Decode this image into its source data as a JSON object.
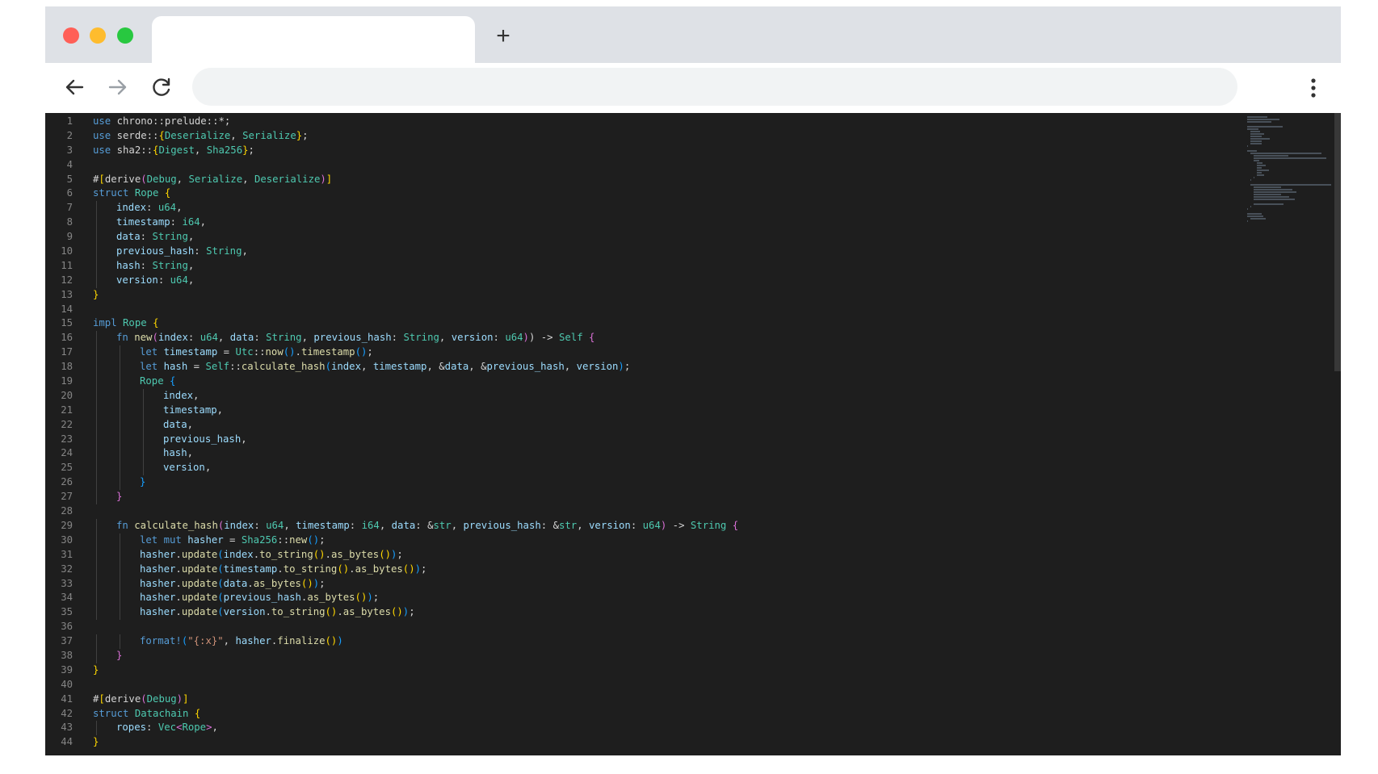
{
  "browser": {
    "new_tab_label": "+",
    "active_tab_title": "",
    "address_text": ""
  },
  "colors": {
    "close": "#ff5f57",
    "minimize": "#febc2e",
    "maximize": "#28c840",
    "editor_background": "#1e1e1e"
  },
  "icons": {
    "back": "arrow-left-icon",
    "forward": "arrow-right-icon",
    "reload": "reload-icon",
    "menu": "kebab-menu-icon"
  },
  "editor": {
    "lines": [
      {
        "n": "1",
        "i": 0,
        "t": [
          [
            "kw",
            "use "
          ],
          [
            "",
            "chrono::prelude::*;"
          ]
        ]
      },
      {
        "n": "2",
        "i": 0,
        "t": [
          [
            "kw",
            "use "
          ],
          [
            "",
            "serde::"
          ],
          [
            "p1",
            "{"
          ],
          [
            "ty",
            "Deserialize"
          ],
          [
            "",
            ", "
          ],
          [
            "ty",
            "Serialize"
          ],
          [
            "p1",
            "}"
          ],
          [
            "",
            ";"
          ]
        ]
      },
      {
        "n": "3",
        "i": 0,
        "t": [
          [
            "kw",
            "use "
          ],
          [
            "",
            "sha2::"
          ],
          [
            "p1",
            "{"
          ],
          [
            "ty",
            "Digest"
          ],
          [
            "",
            ", "
          ],
          [
            "ty",
            "Sha256"
          ],
          [
            "p1",
            "}"
          ],
          [
            "",
            ";"
          ]
        ]
      },
      {
        "n": "4",
        "i": 0,
        "t": []
      },
      {
        "n": "5",
        "i": 0,
        "t": [
          [
            "",
            "#"
          ],
          [
            "p1",
            "["
          ],
          [
            "",
            "derive"
          ],
          [
            "p2",
            "("
          ],
          [
            "ty",
            "Debug"
          ],
          [
            "",
            ", "
          ],
          [
            "ty",
            "Serialize"
          ],
          [
            "",
            ", "
          ],
          [
            "ty",
            "Deserialize"
          ],
          [
            "p2",
            ")"
          ],
          [
            "p1",
            "]"
          ]
        ]
      },
      {
        "n": "6",
        "i": 0,
        "t": [
          [
            "kw",
            "struct "
          ],
          [
            "ty",
            "Rope "
          ],
          [
            "p1",
            "{"
          ]
        ]
      },
      {
        "n": "7",
        "i": 1,
        "t": [
          [
            "var",
            "index"
          ],
          [
            "",
            ": "
          ],
          [
            "ty",
            "u64"
          ],
          [
            "",
            ","
          ]
        ]
      },
      {
        "n": "8",
        "i": 1,
        "t": [
          [
            "var",
            "timestamp"
          ],
          [
            "",
            ": "
          ],
          [
            "ty",
            "i64"
          ],
          [
            "",
            ","
          ]
        ]
      },
      {
        "n": "9",
        "i": 1,
        "t": [
          [
            "var",
            "data"
          ],
          [
            "",
            ": "
          ],
          [
            "ty",
            "String"
          ],
          [
            "",
            ","
          ]
        ]
      },
      {
        "n": "10",
        "i": 1,
        "t": [
          [
            "var",
            "previous_hash"
          ],
          [
            "",
            ": "
          ],
          [
            "ty",
            "String"
          ],
          [
            "",
            ","
          ]
        ]
      },
      {
        "n": "11",
        "i": 1,
        "t": [
          [
            "var",
            "hash"
          ],
          [
            "",
            ": "
          ],
          [
            "ty",
            "String"
          ],
          [
            "",
            ","
          ]
        ]
      },
      {
        "n": "12",
        "i": 1,
        "t": [
          [
            "var",
            "version"
          ],
          [
            "",
            ": "
          ],
          [
            "ty",
            "u64"
          ],
          [
            "",
            ","
          ]
        ]
      },
      {
        "n": "13",
        "i": 0,
        "t": [
          [
            "p1",
            "}"
          ]
        ]
      },
      {
        "n": "14",
        "i": 0,
        "t": []
      },
      {
        "n": "15",
        "i": 0,
        "t": [
          [
            "kw",
            "impl "
          ],
          [
            "ty",
            "Rope "
          ],
          [
            "p1",
            "{"
          ]
        ]
      },
      {
        "n": "16",
        "i": 1,
        "t": [
          [
            "kw",
            "fn "
          ],
          [
            "fn",
            "new"
          ],
          [
            "p2",
            "("
          ],
          [
            "var",
            "index"
          ],
          [
            "",
            ": "
          ],
          [
            "ty",
            "u64"
          ],
          [
            "",
            ", "
          ],
          [
            "var",
            "data"
          ],
          [
            "",
            ": "
          ],
          [
            "ty",
            "String"
          ],
          [
            "",
            ", "
          ],
          [
            "var",
            "previous_hash"
          ],
          [
            "",
            ": "
          ],
          [
            "ty",
            "String"
          ],
          [
            "",
            ", "
          ],
          [
            "var",
            "version"
          ],
          [
            "",
            ": "
          ],
          [
            "ty",
            "u64"
          ],
          [
            "p2",
            ")"
          ],
          [
            "",
            ") -> "
          ],
          [
            "ty",
            "Self "
          ],
          [
            "p2",
            "{"
          ]
        ]
      },
      {
        "n": "17",
        "i": 2,
        "t": [
          [
            "kw",
            "let "
          ],
          [
            "var",
            "timestamp"
          ],
          [
            "",
            " = "
          ],
          [
            "ty",
            "Utc"
          ],
          [
            "",
            "::"
          ],
          [
            "fn",
            "now"
          ],
          [
            "p3",
            "()"
          ],
          [
            "",
            "."
          ],
          [
            "fn",
            "timestamp"
          ],
          [
            "p3",
            "()"
          ],
          [
            "",
            ";"
          ]
        ]
      },
      {
        "n": "18",
        "i": 2,
        "t": [
          [
            "kw",
            "let "
          ],
          [
            "var",
            "hash"
          ],
          [
            "",
            " = "
          ],
          [
            "ty",
            "Self"
          ],
          [
            "",
            "::"
          ],
          [
            "fn",
            "calculate_hash"
          ],
          [
            "p3",
            "("
          ],
          [
            "var",
            "index"
          ],
          [
            "",
            ", "
          ],
          [
            "var",
            "timestamp"
          ],
          [
            "",
            ", &"
          ],
          [
            "var",
            "data"
          ],
          [
            "",
            ", &"
          ],
          [
            "var",
            "previous_hash"
          ],
          [
            "",
            ", "
          ],
          [
            "var",
            "version"
          ],
          [
            "p3",
            ")"
          ],
          [
            "",
            ";"
          ]
        ]
      },
      {
        "n": "19",
        "i": 2,
        "t": [
          [
            "ty",
            "Rope "
          ],
          [
            "p3",
            "{"
          ]
        ]
      },
      {
        "n": "20",
        "i": 3,
        "t": [
          [
            "var",
            "index"
          ],
          [
            "",
            ","
          ]
        ]
      },
      {
        "n": "21",
        "i": 3,
        "t": [
          [
            "var",
            "timestamp"
          ],
          [
            "",
            ","
          ]
        ]
      },
      {
        "n": "22",
        "i": 3,
        "t": [
          [
            "var",
            "data"
          ],
          [
            "",
            ","
          ]
        ]
      },
      {
        "n": "23",
        "i": 3,
        "t": [
          [
            "var",
            "previous_hash"
          ],
          [
            "",
            ","
          ]
        ]
      },
      {
        "n": "24",
        "i": 3,
        "t": [
          [
            "var",
            "hash"
          ],
          [
            "",
            ","
          ]
        ]
      },
      {
        "n": "25",
        "i": 3,
        "t": [
          [
            "var",
            "version"
          ],
          [
            "",
            ","
          ]
        ]
      },
      {
        "n": "26",
        "i": 2,
        "t": [
          [
            "p3",
            "}"
          ]
        ]
      },
      {
        "n": "27",
        "i": 1,
        "t": [
          [
            "p2",
            "}"
          ]
        ]
      },
      {
        "n": "28",
        "i": 0,
        "t": []
      },
      {
        "n": "29",
        "i": 1,
        "t": [
          [
            "kw",
            "fn "
          ],
          [
            "fn",
            "calculate_hash"
          ],
          [
            "p2",
            "("
          ],
          [
            "var",
            "index"
          ],
          [
            "",
            ": "
          ],
          [
            "ty",
            "u64"
          ],
          [
            "",
            ", "
          ],
          [
            "var",
            "timestamp"
          ],
          [
            "",
            ": "
          ],
          [
            "ty",
            "i64"
          ],
          [
            "",
            ", "
          ],
          [
            "var",
            "data"
          ],
          [
            "",
            ": &"
          ],
          [
            "ty",
            "str"
          ],
          [
            "",
            ", "
          ],
          [
            "var",
            "previous_hash"
          ],
          [
            "",
            ": &"
          ],
          [
            "ty",
            "str"
          ],
          [
            "",
            ", "
          ],
          [
            "var",
            "version"
          ],
          [
            "",
            ": "
          ],
          [
            "ty",
            "u64"
          ],
          [
            "p2",
            ")"
          ],
          [
            "",
            " -> "
          ],
          [
            "ty",
            "String "
          ],
          [
            "p2",
            "{"
          ]
        ]
      },
      {
        "n": "30",
        "i": 2,
        "t": [
          [
            "kw",
            "let mut "
          ],
          [
            "var",
            "hasher"
          ],
          [
            "",
            " = "
          ],
          [
            "ty",
            "Sha256"
          ],
          [
            "",
            "::"
          ],
          [
            "fn",
            "new"
          ],
          [
            "p3",
            "()"
          ],
          [
            "",
            ";"
          ]
        ]
      },
      {
        "n": "31",
        "i": 2,
        "t": [
          [
            "var",
            "hasher"
          ],
          [
            "",
            "."
          ],
          [
            "fn",
            "update"
          ],
          [
            "p3",
            "("
          ],
          [
            "var",
            "index"
          ],
          [
            "",
            "."
          ],
          [
            "fn",
            "to_string"
          ],
          [
            "p1",
            "()"
          ],
          [
            "",
            "."
          ],
          [
            "fn",
            "as_bytes"
          ],
          [
            "p1",
            "()"
          ],
          [
            "p3",
            ")"
          ],
          [
            "",
            ";"
          ]
        ]
      },
      {
        "n": "32",
        "i": 2,
        "t": [
          [
            "var",
            "hasher"
          ],
          [
            "",
            "."
          ],
          [
            "fn",
            "update"
          ],
          [
            "p3",
            "("
          ],
          [
            "var",
            "timestamp"
          ],
          [
            "",
            "."
          ],
          [
            "fn",
            "to_string"
          ],
          [
            "p1",
            "()"
          ],
          [
            "",
            "."
          ],
          [
            "fn",
            "as_bytes"
          ],
          [
            "p1",
            "()"
          ],
          [
            "p3",
            ")"
          ],
          [
            "",
            ";"
          ]
        ]
      },
      {
        "n": "33",
        "i": 2,
        "t": [
          [
            "var",
            "hasher"
          ],
          [
            "",
            "."
          ],
          [
            "fn",
            "update"
          ],
          [
            "p3",
            "("
          ],
          [
            "var",
            "data"
          ],
          [
            "",
            "."
          ],
          [
            "fn",
            "as_bytes"
          ],
          [
            "p1",
            "()"
          ],
          [
            "p3",
            ")"
          ],
          [
            "",
            ";"
          ]
        ]
      },
      {
        "n": "34",
        "i": 2,
        "t": [
          [
            "var",
            "hasher"
          ],
          [
            "",
            "."
          ],
          [
            "fn",
            "update"
          ],
          [
            "p3",
            "("
          ],
          [
            "var",
            "previous_hash"
          ],
          [
            "",
            "."
          ],
          [
            "fn",
            "as_bytes"
          ],
          [
            "p1",
            "()"
          ],
          [
            "p3",
            ")"
          ],
          [
            "",
            ";"
          ]
        ]
      },
      {
        "n": "35",
        "i": 2,
        "t": [
          [
            "var",
            "hasher"
          ],
          [
            "",
            "."
          ],
          [
            "fn",
            "update"
          ],
          [
            "p3",
            "("
          ],
          [
            "var",
            "version"
          ],
          [
            "",
            "."
          ],
          [
            "fn",
            "to_string"
          ],
          [
            "p1",
            "()"
          ],
          [
            "",
            "."
          ],
          [
            "fn",
            "as_bytes"
          ],
          [
            "p1",
            "()"
          ],
          [
            "p3",
            ")"
          ],
          [
            "",
            ";"
          ]
        ]
      },
      {
        "n": "36",
        "i": 0,
        "t": []
      },
      {
        "n": "37",
        "i": 2,
        "t": [
          [
            "mac",
            "format!"
          ],
          [
            "p3",
            "("
          ],
          [
            "str",
            "\"{:x}\""
          ],
          [
            "",
            ", "
          ],
          [
            "var",
            "hasher"
          ],
          [
            "",
            "."
          ],
          [
            "fn",
            "finalize"
          ],
          [
            "p1",
            "()"
          ],
          [
            "p3",
            ")"
          ]
        ]
      },
      {
        "n": "38",
        "i": 1,
        "t": [
          [
            "p2",
            "}"
          ]
        ]
      },
      {
        "n": "39",
        "i": 0,
        "t": [
          [
            "p1",
            "}"
          ]
        ]
      },
      {
        "n": "40",
        "i": 0,
        "t": []
      },
      {
        "n": "41",
        "i": 0,
        "t": [
          [
            "",
            "#"
          ],
          [
            "p1",
            "["
          ],
          [
            "",
            "derive"
          ],
          [
            "p2",
            "("
          ],
          [
            "ty",
            "Debug"
          ],
          [
            "p2",
            ")"
          ],
          [
            "p1",
            "]"
          ]
        ]
      },
      {
        "n": "42",
        "i": 0,
        "t": [
          [
            "kw",
            "struct "
          ],
          [
            "ty",
            "Datachain "
          ],
          [
            "p1",
            "{"
          ]
        ]
      },
      {
        "n": "43",
        "i": 1,
        "t": [
          [
            "var",
            "ropes"
          ],
          [
            "",
            ": "
          ],
          [
            "ty",
            "Vec"
          ],
          [
            "p2",
            "<"
          ],
          [
            "ty",
            "Rope"
          ],
          [
            "p2",
            ">"
          ],
          [
            "",
            ","
          ]
        ]
      },
      {
        "n": "44",
        "i": 0,
        "t": [
          [
            "p1",
            "}"
          ]
        ]
      }
    ]
  }
}
